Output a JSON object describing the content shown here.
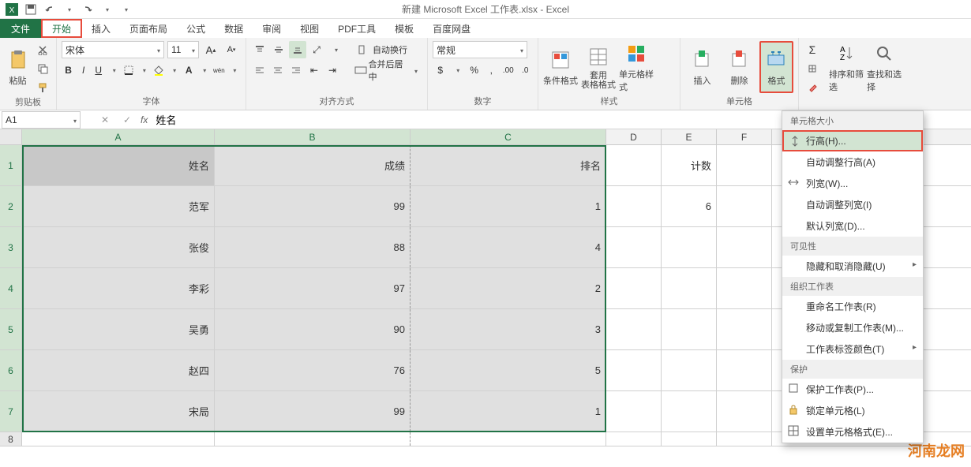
{
  "title": "新建 Microsoft Excel 工作表.xlsx - Excel",
  "qat": {
    "save": "保存",
    "undo": "撤销",
    "redo": "重做"
  },
  "tabs": {
    "file": "文件",
    "home": "开始",
    "insert": "插入",
    "layout": "页面布局",
    "formulas": "公式",
    "data": "数据",
    "review": "审阅",
    "view": "视图",
    "pdf": "PDF工具",
    "template": "模板",
    "baidu": "百度网盘"
  },
  "ribbon": {
    "clipboard": {
      "label": "剪贴板",
      "paste": "粘贴"
    },
    "font": {
      "label": "字体",
      "name": "宋体",
      "size": "11"
    },
    "alignment": {
      "label": "对齐方式",
      "wrap": "自动换行",
      "merge": "合并后居中"
    },
    "number": {
      "label": "数字",
      "format": "常规"
    },
    "styles": {
      "label": "样式",
      "conditional": "条件格式",
      "table": "套用\n表格格式",
      "cell": "单元格样式"
    },
    "cells": {
      "label": "单元格",
      "insert": "插入",
      "delete": "删除",
      "format": "格式"
    },
    "editing": {
      "sort": "排序和筛选",
      "find": "查找和选择"
    }
  },
  "formula_bar": {
    "name_box": "A1",
    "fx": "fx",
    "value": "姓名"
  },
  "columns": [
    "A",
    "B",
    "C",
    "D",
    "E",
    "F"
  ],
  "rows": [
    {
      "n": 1,
      "a": "姓名",
      "b": "成绩",
      "c": "排名",
      "e": "计数"
    },
    {
      "n": 2,
      "a": "范军",
      "b": "99",
      "c": "1",
      "e": "6"
    },
    {
      "n": 3,
      "a": "张俊",
      "b": "88",
      "c": "4"
    },
    {
      "n": 4,
      "a": "李彩",
      "b": "97",
      "c": "2"
    },
    {
      "n": 5,
      "a": "吴勇",
      "b": "90",
      "c": "3"
    },
    {
      "n": 6,
      "a": "赵四",
      "b": "76",
      "c": "5"
    },
    {
      "n": 7,
      "a": "宋局",
      "b": "99",
      "c": "1"
    }
  ],
  "format_menu": {
    "section1": "单元格大小",
    "row_height": "行高(H)...",
    "autofit_row": "自动调整行高(A)",
    "col_width": "列宽(W)...",
    "autofit_col": "自动调整列宽(I)",
    "default_width": "默认列宽(D)...",
    "section2": "可见性",
    "hide": "隐藏和取消隐藏(U)",
    "section3": "组织工作表",
    "rename": "重命名工作表(R)",
    "move": "移动或复制工作表(M)...",
    "tab_color": "工作表标签颜色(T)",
    "section4": "保护",
    "protect": "保护工作表(P)...",
    "lock": "锁定单元格(L)",
    "format_cells": "设置单元格格式(E)..."
  },
  "watermark": "河南龙网"
}
